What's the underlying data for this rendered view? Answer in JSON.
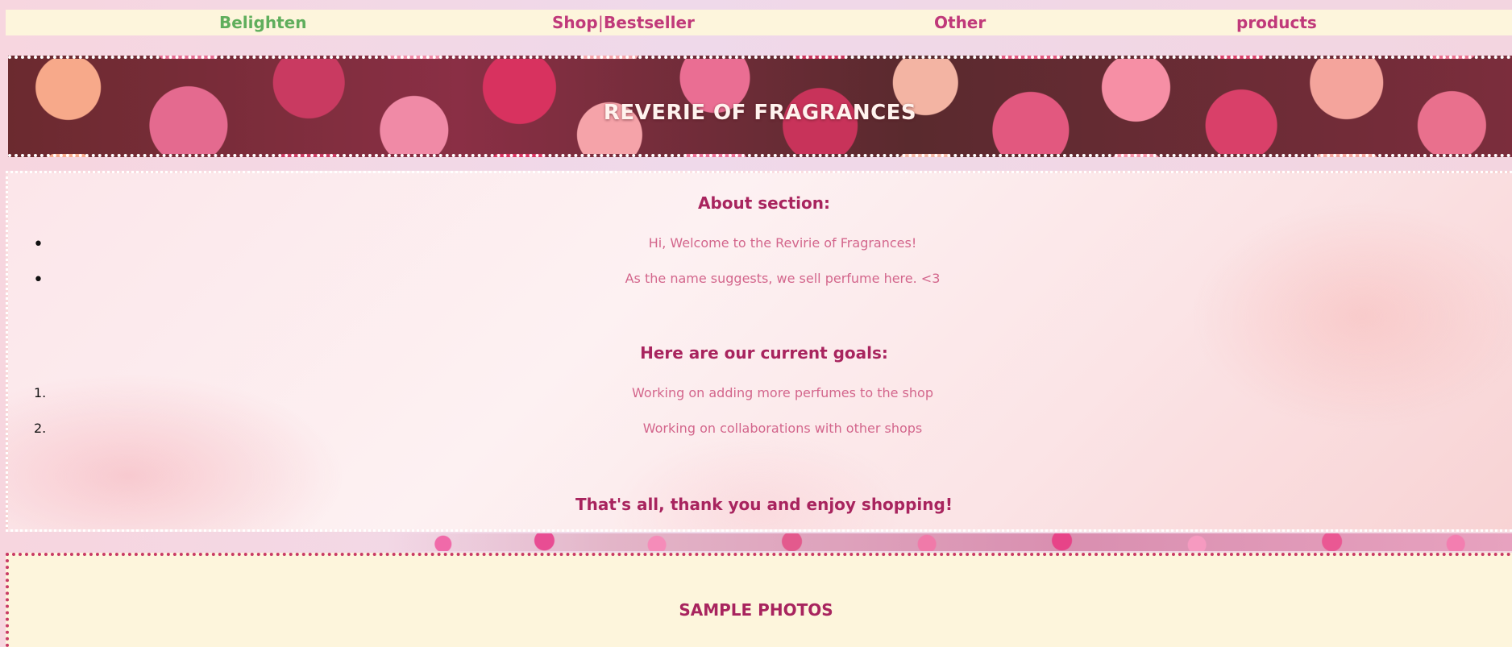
{
  "nav": {
    "brand": "Belighten",
    "shop": "Shop",
    "separator": "|",
    "bestseller": "Bestseller",
    "other": "Other",
    "products": "products"
  },
  "hero": {
    "title": "REVERIE OF FRAGRANCES"
  },
  "about": {
    "heading": "About section:",
    "bullets": [
      "Hi, Welcome to the Revirie of Fragrances!",
      "As the name suggests, we sell perfume here. <3"
    ],
    "goals_heading": "Here are our current goals:",
    "goals": [
      "Working on adding more perfumes to the shop",
      "Working on collaborations with other shops"
    ],
    "goal_markers": [
      "1.",
      "2."
    ],
    "closing": "That's all, thank you and enjoy shopping!"
  },
  "samples": {
    "title": "SAMPLE PHOTOS"
  },
  "colors": {
    "brand_green": "#5fae5c",
    "accent_magenta": "#a8245e",
    "nav_pink": "#c0397a",
    "body_pink": "#d3668c",
    "cream": "#fdf5dc"
  }
}
